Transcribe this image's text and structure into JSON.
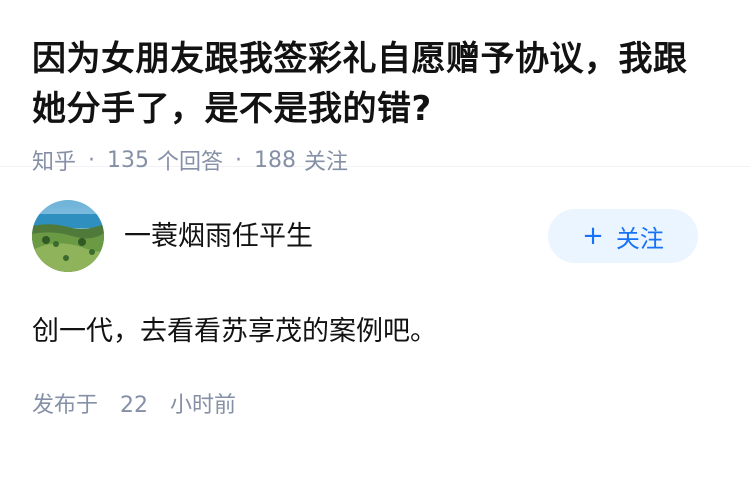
{
  "question": {
    "title": "因为女朋友跟我签彩礼自愿赠予协议，我跟她分手了，是不是我的错?",
    "source": "知乎",
    "separator": "·",
    "answer_count": "135",
    "answer_label": "个回答",
    "follower_count": "188",
    "follower_label": "关注"
  },
  "answer": {
    "author_name": "一蓑烟雨任平生",
    "follow_plus": "+",
    "follow_label": "关注",
    "content": "创一代，去看看苏享茂的案例吧。",
    "posted_label": "发布于",
    "posted_value": "22",
    "posted_unit": "小时前"
  },
  "colors": {
    "accent": "#1772f6",
    "follow_bg": "#ebf5ff",
    "meta_gray": "#8590a6",
    "text": "#121212"
  }
}
